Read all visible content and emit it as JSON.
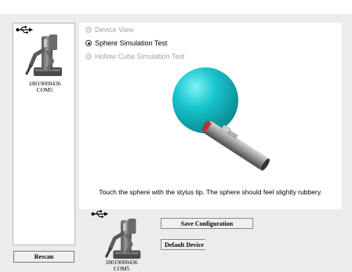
{
  "left_panel": {
    "device": {
      "serial": "18019000436",
      "port": "COM5"
    },
    "rescan_label": "Rescan"
  },
  "main_panel": {
    "options": [
      {
        "label": "Device View",
        "selected": false,
        "enabled": false
      },
      {
        "label": "Sphere Simulation Test",
        "selected": true,
        "enabled": true
      },
      {
        "label": "Hollow Cube Simulation Test",
        "selected": false,
        "enabled": false
      }
    ],
    "instruction": "Touch the sphere with the stylus tip. The sphere should feel slightly rubbery."
  },
  "bottom": {
    "device": {
      "serial": "18019000436",
      "port": "COM5"
    },
    "save_label": "Save Configuration",
    "default_label": "Default Device"
  },
  "colors": {
    "sphere": "#17c4cc",
    "stylus": "#7a7a7a",
    "background": "#ececec"
  },
  "icons": [
    "usb-icon",
    "haptic-device-icon"
  ]
}
